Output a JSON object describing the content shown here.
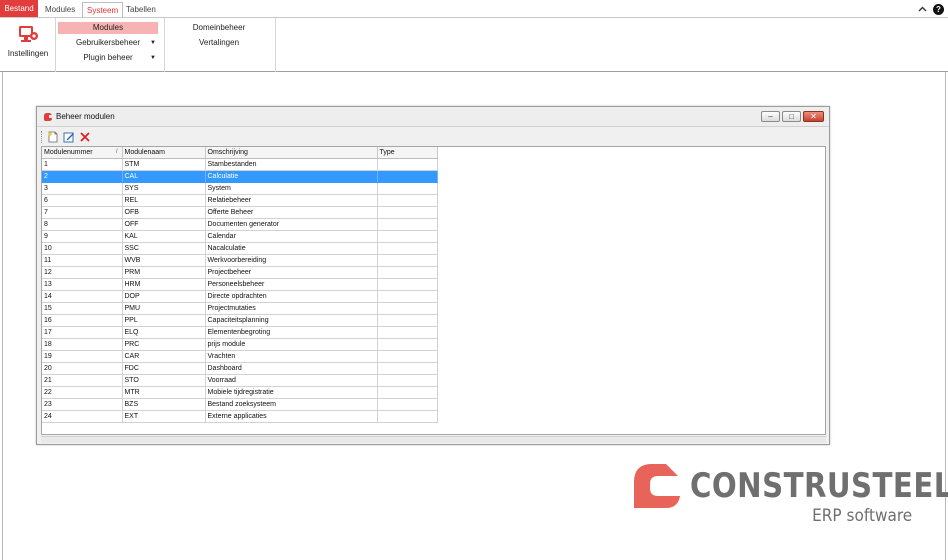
{
  "tabs": [
    {
      "label": "Bestand"
    },
    {
      "label": "Modules"
    },
    {
      "label": "Systeem"
    },
    {
      "label": "Tabellen"
    }
  ],
  "ribbon": {
    "settings_label": "Instellingen",
    "group2": [
      {
        "label": "Modules"
      },
      {
        "label": "Gebruikersbeheer"
      },
      {
        "label": "Plugin beheer"
      }
    ],
    "group3": [
      {
        "label": "Domeinbeheer"
      },
      {
        "label": "Vertalingen"
      }
    ]
  },
  "window": {
    "title": "Beheer modulen",
    "columns": [
      "Modulenummer",
      "Modulenaam",
      "Omschrijving",
      "Type"
    ],
    "sort_indicator": "/",
    "rows": [
      [
        "1",
        "STM",
        "Stambestanden",
        ""
      ],
      [
        "2",
        "CAL",
        "Calculatie",
        ""
      ],
      [
        "3",
        "SYS",
        "System",
        ""
      ],
      [
        "6",
        "REL",
        "Relatiebeheer",
        ""
      ],
      [
        "7",
        "OFB",
        "Offerte Beheer",
        ""
      ],
      [
        "8",
        "OFF",
        "Documenten generator",
        ""
      ],
      [
        "9",
        "KAL",
        "Calendar",
        ""
      ],
      [
        "10",
        "SSC",
        "Nacalculatie",
        ""
      ],
      [
        "11",
        "WVB",
        "Werkvoorbereiding",
        ""
      ],
      [
        "12",
        "PRM",
        "Projectbeheer",
        ""
      ],
      [
        "13",
        "HRM",
        "Personeelsbeheer",
        ""
      ],
      [
        "14",
        "DOP",
        "Directe opdrachten",
        ""
      ],
      [
        "15",
        "PMU",
        "Projectmutaties",
        ""
      ],
      [
        "16",
        "PPL",
        "Capaciteitsplanning",
        ""
      ],
      [
        "17",
        "ELQ",
        "Elementenbegroting",
        ""
      ],
      [
        "18",
        "PRC",
        "prijs module",
        ""
      ],
      [
        "19",
        "CAR",
        "Vrachten",
        ""
      ],
      [
        "20",
        "FDC",
        "Dashboard",
        ""
      ],
      [
        "21",
        "STO",
        "Voorraad",
        ""
      ],
      [
        "22",
        "MTR",
        "Mobiele tijdregistratie",
        ""
      ],
      [
        "23",
        "BZS",
        "Bestand zoeksysteem",
        ""
      ],
      [
        "24",
        "EXT",
        "Externe applicaties",
        ""
      ]
    ]
  },
  "logo": {
    "name": "CONSTRUSTEEL",
    "tagline": "ERP software"
  },
  "colors": {
    "accent": "#e23c3c",
    "ribbon_selected": "#f7b3b3",
    "row_selected": "#3399ff",
    "logo_gray": "#6f6f6f",
    "logo_red": "#e8635a"
  },
  "icons": [
    "settings-icon",
    "help-icon",
    "collapse-ribbon-icon",
    "new-record-icon",
    "edit-record-icon",
    "delete-record-icon",
    "window-app-icon",
    "minimize-icon",
    "restore-icon",
    "close-icon"
  ]
}
